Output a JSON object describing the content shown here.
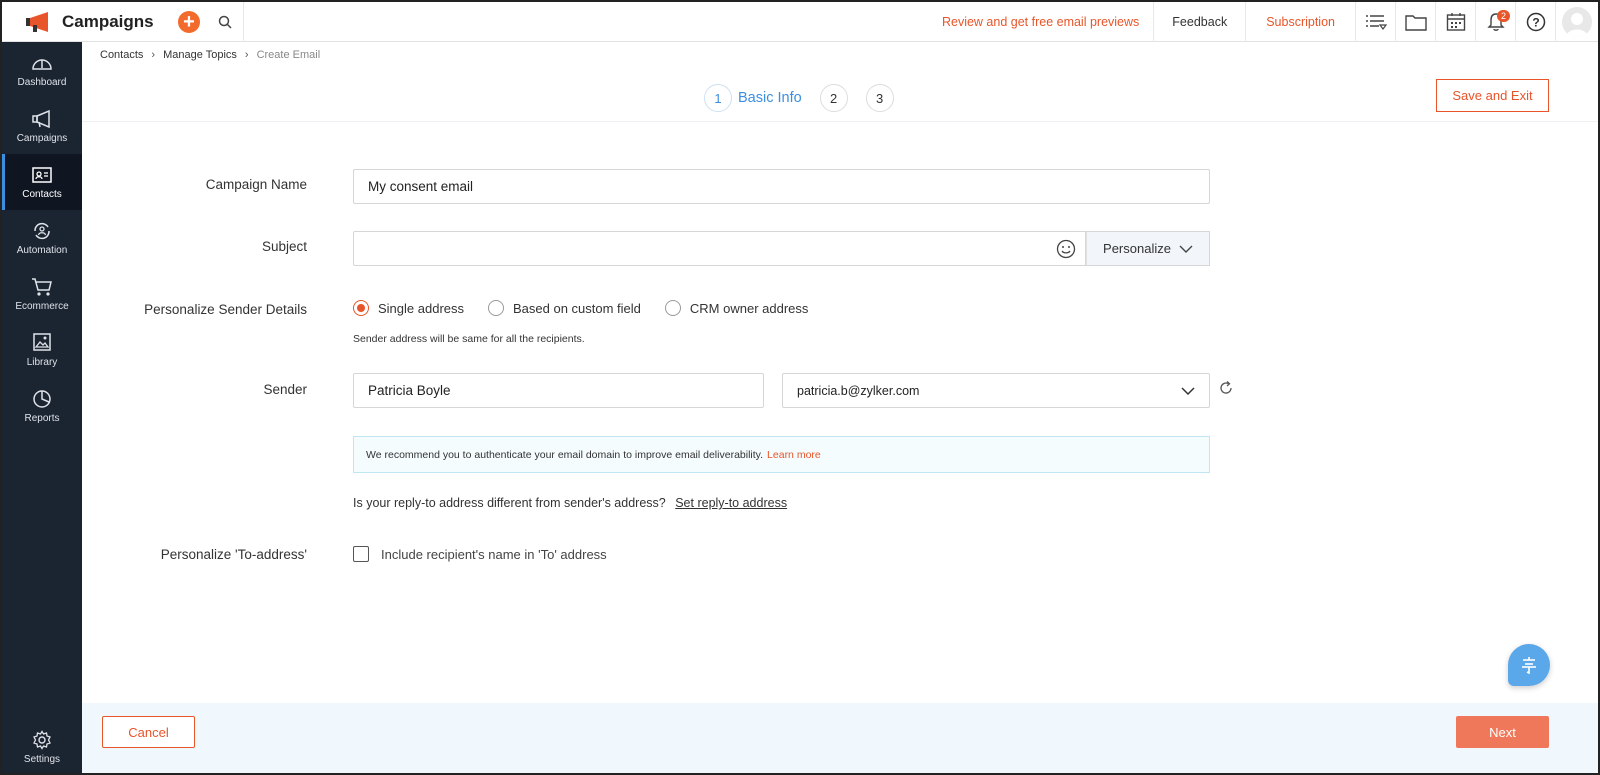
{
  "app": {
    "title": "Campaigns",
    "accent": "#f26b2d",
    "sidebar_bg": "#1b2431",
    "link_blue": "#3c8fe0"
  },
  "topbar": {
    "review_link": "Review and get free email previews",
    "feedback": "Feedback",
    "subscription": "Subscription",
    "notification_count": "2",
    "icons": [
      "list-icon",
      "folder-icon",
      "calendar-icon",
      "bell-icon",
      "help-icon",
      "avatar"
    ]
  },
  "sidebar": {
    "items": [
      {
        "label": "Dashboard",
        "icon": "dashboard-icon"
      },
      {
        "label": "Campaigns",
        "icon": "megaphone-icon"
      },
      {
        "label": "Contacts",
        "icon": "contact-card-icon",
        "active": true
      },
      {
        "label": "Automation",
        "icon": "automation-icon"
      },
      {
        "label": "Ecommerce",
        "icon": "cart-icon"
      },
      {
        "label": "Library",
        "icon": "image-library-icon"
      },
      {
        "label": "Reports",
        "icon": "pie-chart-icon"
      }
    ],
    "settings": "Settings"
  },
  "breadcrumb": {
    "item1": "Contacts",
    "item2": "Manage Topics",
    "current": "Create Email"
  },
  "steps": {
    "step1": "1",
    "step1_label": "Basic Info",
    "step2": "2",
    "step3": "3"
  },
  "save_exit": "Save and Exit",
  "form": {
    "campaign_name_label": "Campaign Name",
    "campaign_name_value": "My consent email",
    "subject_label": "Subject",
    "subject_value": "",
    "personalize_btn": "Personalize",
    "sender_details_label": "Personalize Sender Details",
    "radio_single": "Single address",
    "radio_custom": "Based on custom field",
    "radio_crm": "CRM owner address",
    "radio_hint": "Sender address will be same for all the recipients.",
    "sender_label": "Sender",
    "sender_name": "Patricia Boyle",
    "sender_email": "patricia.b@zylker.com",
    "info_text": "We recommend you to authenticate your email domain to improve email deliverability.",
    "info_link": "Learn more",
    "reply_question": "Is your reply-to address different from sender's address?",
    "reply_link": "Set reply-to address",
    "to_address_label": "Personalize 'To-address'",
    "to_address_checkbox": "Include recipient's name in 'To' address"
  },
  "footer": {
    "cancel": "Cancel",
    "next": "Next"
  }
}
